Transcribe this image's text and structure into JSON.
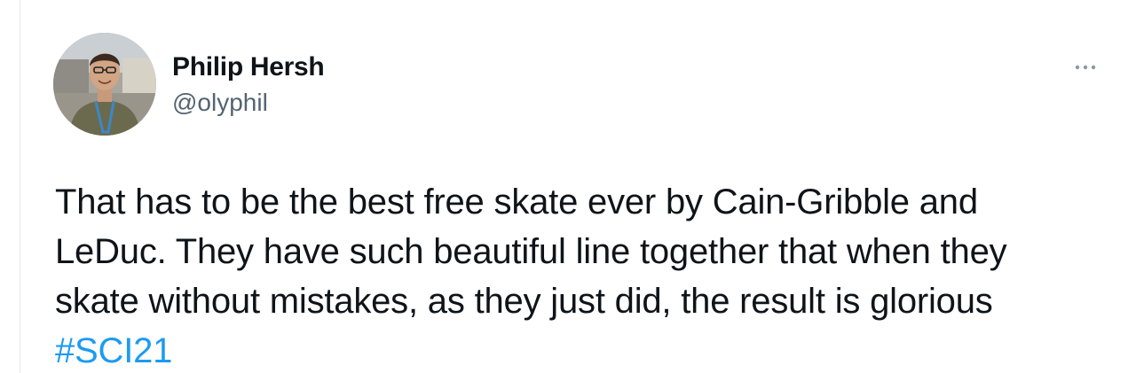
{
  "author": {
    "name": "Philip Hersh",
    "handle": "@olyphil",
    "avatar_icon": "profile-photo"
  },
  "menu": {
    "icon": "more-icon"
  },
  "tweet": {
    "lines": [
      "That has to be the best free skate ever by Cain-Gribble and",
      "LeDuc.  They have such beautiful line together that when they",
      "skate without mistakes, as they just did, the result is glorious"
    ],
    "hashtag": "#SCI21"
  },
  "colors": {
    "text": "#0f1419",
    "secondary": "#536471",
    "link": "#1d9bf0",
    "background": "#ffffff"
  }
}
